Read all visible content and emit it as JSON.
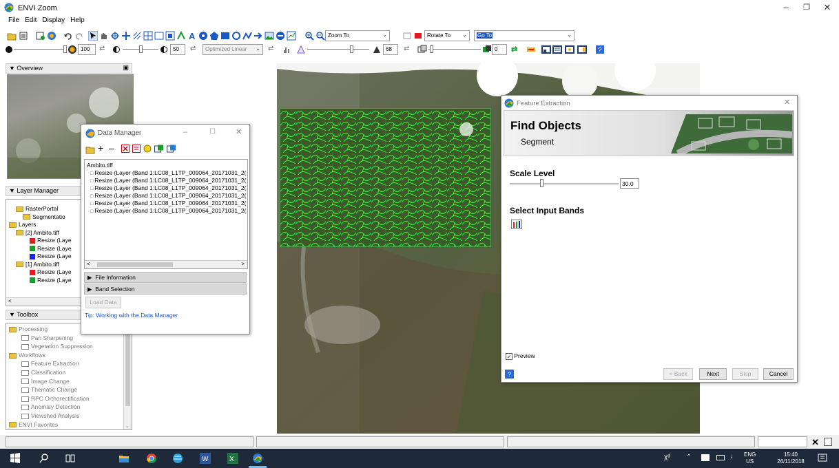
{
  "window": {
    "title": "ENVI Zoom"
  },
  "menu": [
    "File",
    "Edit",
    "Display",
    "Help"
  ],
  "toolbar": {
    "zoom_combo": "Zoom To",
    "rotate_combo": "Rotate To",
    "goto_combo": "Go To",
    "brightness_value": "100",
    "contrast_value": "50",
    "stretch_combo": "Optimized Linear",
    "sharpen_value": "68",
    "transparency_value": "0"
  },
  "overview": {
    "title": "Overview"
  },
  "layer_manager": {
    "title": "Layer Manager",
    "items": [
      {
        "label": "RasterPortal",
        "indent": 1
      },
      {
        "label": "Segmentatio",
        "indent": 2
      },
      {
        "label": "Layers",
        "indent": 0
      },
      {
        "label": "[2] Ambito.tiff",
        "indent": 1
      },
      {
        "label": "Resize (Laye",
        "indent": 3,
        "color": "#e8191c"
      },
      {
        "label": "Resize (Laye",
        "indent": 3,
        "color": "#1a9b2c"
      },
      {
        "label": "Resize (Laye",
        "indent": 3,
        "color": "#1626d8"
      },
      {
        "label": "[1] Ambito.tiff",
        "indent": 1
      },
      {
        "label": "Resize (Laye",
        "indent": 3,
        "color": "#e8191c"
      },
      {
        "label": "Resize (Laye",
        "indent": 3,
        "color": "#1a9b2c"
      }
    ]
  },
  "toolbox": {
    "title": "Toolbox",
    "items": [
      {
        "label": "Processing",
        "indent": 0,
        "folder": true
      },
      {
        "label": "Pan Sharpening",
        "indent": 2
      },
      {
        "label": "Vegetation Suppression",
        "indent": 2
      },
      {
        "label": "Workflows",
        "indent": 0,
        "folder": true
      },
      {
        "label": "Feature Extraction",
        "indent": 2
      },
      {
        "label": "Classification",
        "indent": 2
      },
      {
        "label": "Image Change",
        "indent": 2
      },
      {
        "label": "Thematic Change",
        "indent": 2
      },
      {
        "label": "RPC Orthorectification",
        "indent": 2
      },
      {
        "label": "Anomaly Detection",
        "indent": 2
      },
      {
        "label": "Viewshed Analysis",
        "indent": 2
      },
      {
        "label": "ENVI Favorites",
        "indent": 0,
        "folder": true
      }
    ]
  },
  "data_manager": {
    "title": "Data Manager",
    "root": "Ambito.tiff",
    "items": [
      "Resize (Layer (Band 1:LC08_L1TP_009064_20171031_2(",
      "Resize (Layer (Band 1:LC08_L1TP_009064_20171031_2(",
      "Resize (Layer (Band 1:LC08_L1TP_009064_20171031_2(",
      "Resize (Layer (Band 1:LC08_L1TP_009064_20171031_2(",
      "Resize (Layer (Band 1:LC08_L1TP_009064_20171031_2(",
      "Resize (Layer (Band 1:LC08_L1TP_009064_20171031_2("
    ],
    "section_file_info": "File Information",
    "section_band_selection": "Band Selection",
    "load_button": "Load Data",
    "tip": "Tip: Working with the Data Manager"
  },
  "feature_extraction": {
    "title": "Feature Extraction",
    "header_title": "Find Objects",
    "header_subtitle": "Segment",
    "scale_label": "Scale Level",
    "scale_value": "30.0",
    "scale_fraction": 0.3,
    "bands_label": "Select Input Bands",
    "preview_label": "Preview",
    "preview_checked": true,
    "buttons": {
      "back": "< Back",
      "next": "Next",
      "skip": "Skip",
      "cancel": "Cancel"
    }
  },
  "taskbar": {
    "lang": "ENG",
    "lang2": "US",
    "time": "15:40",
    "date": "26/11/2018"
  },
  "colors": {
    "accent": "#1a58c8",
    "segment_outline": "#33ff33",
    "panel_header": "#ececec"
  }
}
